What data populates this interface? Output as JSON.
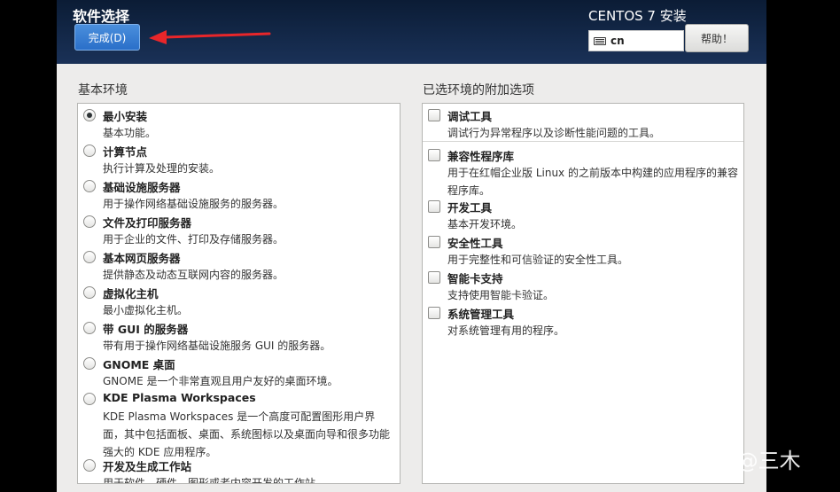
{
  "header": {
    "title": "软件选择",
    "done_label": "完成(D)",
    "product": "CENTOS 7 安装",
    "keyboard_layout": "cn",
    "help_label": "帮助！",
    "keyboard_icon": "keyboard-icon"
  },
  "base_env": {
    "title": "基本环境",
    "items": [
      {
        "name": "最小安装",
        "desc": "基本功能。",
        "selected": true
      },
      {
        "name": "计算节点",
        "desc": "执行计算及处理的安装。"
      },
      {
        "name": "基础设施服务器",
        "desc": "用于操作网络基础设施服务的服务器。"
      },
      {
        "name": "文件及打印服务器",
        "desc": "用于企业的文件、打印及存储服务器。"
      },
      {
        "name": "基本网页服务器",
        "desc": "提供静态及动态互联网内容的服务器。"
      },
      {
        "name": "虚拟化主机",
        "desc": "最小虚拟化主机。"
      },
      {
        "name": "带 GUI 的服务器",
        "desc": "带有用于操作网络基础设施服务 GUI 的服务器。"
      },
      {
        "name": "GNOME 桌面",
        "desc": "GNOME 是一个非常直观且用户友好的桌面环境。"
      },
      {
        "name": "KDE Plasma Workspaces",
        "desc": "KDE Plasma Workspaces 是一个高度可配置图形用户界面，其中包括面板、桌面、系统图标以及桌面向导和很多功能强大的 KDE 应用程序。"
      },
      {
        "name": "开发及生成工作站",
        "desc": "用于软件、硬件、图形或者内容开发的工作站。"
      }
    ]
  },
  "addons": {
    "title": "已选环境的附加选项",
    "items": [
      {
        "name": "调试工具",
        "desc": "调试行为异常程序以及诊断性能问题的工具。"
      },
      {
        "name": "兼容性程序库",
        "desc": "用于在红帽企业版 Linux 的之前版本中构建的应用程序的兼容程序库。"
      },
      {
        "name": "开发工具",
        "desc": "基本开发环境。"
      },
      {
        "name": "安全性工具",
        "desc": "用于完整性和可信验证的安全性工具。"
      },
      {
        "name": "智能卡支持",
        "desc": "支持使用智能卡验证。"
      },
      {
        "name": "系统管理工具",
        "desc": "对系统管理有用的程序。"
      }
    ]
  },
  "watermark": "知乎 @三木",
  "colors": {
    "header_bg": "#14294a",
    "done_button": "#2a6fc9",
    "arrow": "#e8262a",
    "window_bg": "#edeceb"
  }
}
